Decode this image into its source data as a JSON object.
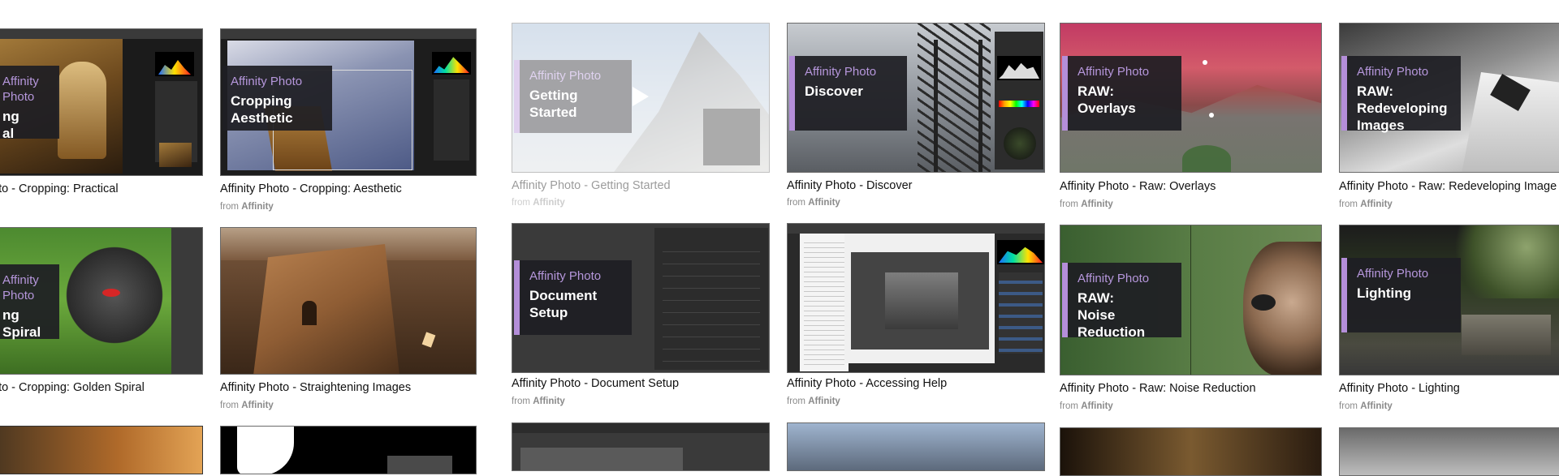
{
  "brand": "Affinity Photo",
  "from_label": "from",
  "publisher": "Affinity",
  "cards": [
    {
      "overlay": "ng\nal",
      "caption": "oto - Cropping: Practical"
    },
    {
      "overlay": "Cropping\nAesthetic",
      "caption": "Affinity Photo - Cropping: Aesthetic"
    },
    {
      "overlay": "Getting Started",
      "caption": "Affinity Photo - Getting Started"
    },
    {
      "overlay": "Discover",
      "caption": "Affinity Photo - Discover"
    },
    {
      "overlay": "RAW:\nOverlays",
      "caption": "Affinity Photo - Raw: Overlays"
    },
    {
      "overlay": "RAW:\nRedeveloping\nImages",
      "caption": "Affinity Photo - Raw: Redeveloping Image"
    },
    {
      "overlay": "ng\n Spiral",
      "caption": "oto - Cropping: Golden Spiral"
    },
    {
      "overlay": "",
      "caption": "Affinity Photo - Straightening Images"
    },
    {
      "overlay": "Document\nSetup",
      "caption": "Affinity Photo - Document Setup"
    },
    {
      "overlay": "",
      "caption": "Affinity Photo - Accessing Help"
    },
    {
      "overlay": "RAW:\nNoise Reduction",
      "caption": "Affinity Photo - Raw: Noise Reduction"
    },
    {
      "overlay": "Lighting",
      "caption": "Affinity Photo - Lighting"
    }
  ]
}
